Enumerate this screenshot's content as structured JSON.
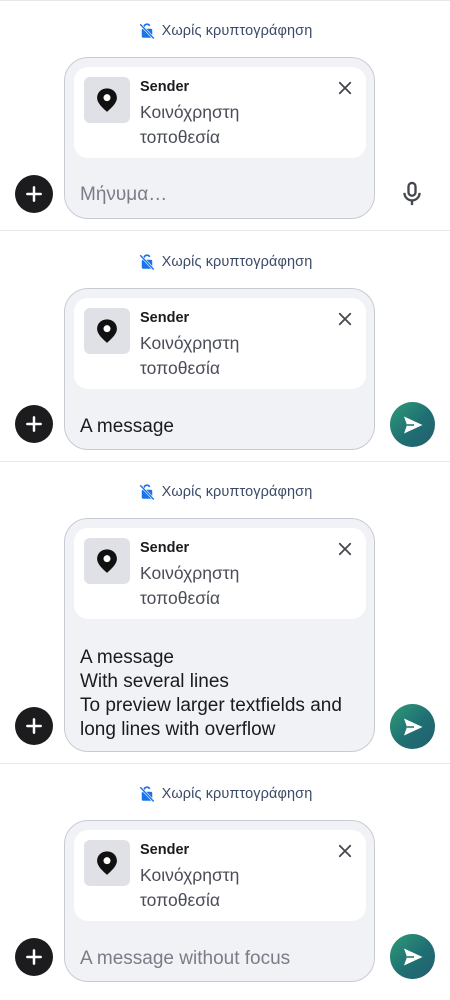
{
  "encryption_label": "Χωρίς κρυπτογράφηση",
  "attachment": {
    "sender": "Sender",
    "description": "Κοινόχρηστη τοποθεσία"
  },
  "states": [
    {
      "kind": "empty",
      "placeholder": "Μήνυμα…",
      "action": "mic-icon"
    },
    {
      "kind": "single-line",
      "text": "A message",
      "action": "send-icon"
    },
    {
      "kind": "multi-line",
      "text": "A message\nWith several lines\nTo preview larger textfields and long lines with overflow",
      "action": "send-icon"
    },
    {
      "kind": "unfocused",
      "text": "A message without focus",
      "action": "send-icon"
    }
  ],
  "icons": {
    "encryption": "no-encryption-lock-icon",
    "add": "plus-icon",
    "location": "location-pin-icon",
    "close": "close-icon",
    "mic": "microphone-icon",
    "send": "send-icon"
  },
  "colors": {
    "encryption_icon": "#1a73e8",
    "encryption_text": "#3b4a66",
    "composer_bg": "#f1f2f6",
    "add_button": "#1c1c1e",
    "send_gradient_start": "#2f9b78",
    "send_gradient_end": "#235d6e"
  }
}
